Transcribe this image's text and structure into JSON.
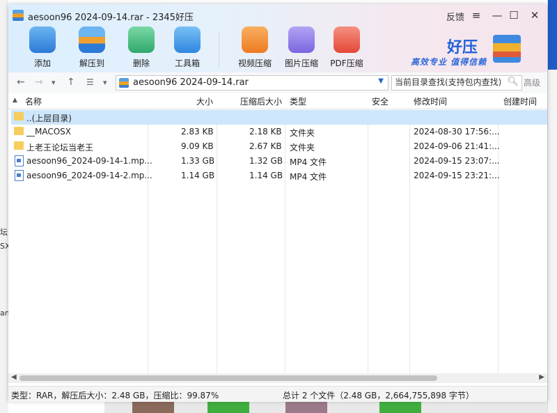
{
  "window": {
    "title": "aesoon96 2024-09-14.rar - 2345好压",
    "feedback_label": "反馈",
    "menu_icon": "≡",
    "minimize_icon": "—",
    "maximize_icon": "☐",
    "close_icon": "✕"
  },
  "toolbar": {
    "items": [
      {
        "label": "添加",
        "icon": "add-archive-icon",
        "color": "#3a8ee0"
      },
      {
        "label": "解压到",
        "icon": "extract-icon",
        "color": "#3a8ee0"
      },
      {
        "label": "删除",
        "icon": "delete-icon",
        "color": "#39b37a"
      },
      {
        "label": "工具箱",
        "icon": "toolbox-icon",
        "color": "#3a9ae6"
      },
      {
        "label": "视频压缩",
        "icon": "video-compress-icon",
        "color": "#f08a2c"
      },
      {
        "label": "图片压缩",
        "icon": "image-compress-icon",
        "color": "#8a7ae8"
      },
      {
        "label": "PDF压缩",
        "icon": "pdf-compress-icon",
        "color": "#ec5a4a"
      }
    ]
  },
  "brand": {
    "name": "好压",
    "slogan": "高效专业  值得信赖"
  },
  "address": {
    "path": "aesoon96 2024-09-14.rar",
    "search_placeholder": "当前目录查找(支持包内查找)",
    "advanced_label": "高级"
  },
  "columns": [
    "名称",
    "大小",
    "压缩后大小",
    "类型",
    "安全",
    "修改时间",
    "创建时间"
  ],
  "rows": [
    {
      "name": "..(上层目录)",
      "size": "",
      "packed": "",
      "type": "",
      "safe": "",
      "modified": "",
      "kind": "folder",
      "selected": true
    },
    {
      "name": "__MACOSX",
      "size": "2.83 KB",
      "packed": "2.18 KB",
      "type": "文件夹",
      "safe": "",
      "modified": "2024-08-30 17:56:...",
      "kind": "folder",
      "selected": false
    },
    {
      "name": "上老王论坛当老王",
      "size": "9.09 KB",
      "packed": "2.67 KB",
      "type": "文件夹",
      "safe": "",
      "modified": "2024-09-06 21:41:...",
      "kind": "folder",
      "selected": false
    },
    {
      "name": "aesoon96_2024-09-14-1.mp...",
      "size": "1.33 GB",
      "packed": "1.32 GB",
      "type": "MP4 文件",
      "safe": "",
      "modified": "2024-09-15 23:07:...",
      "kind": "video",
      "selected": false
    },
    {
      "name": "aesoon96_2024-09-14-2.mp...",
      "size": "1.14 GB",
      "packed": "1.14 GB",
      "type": "MP4 文件",
      "safe": "",
      "modified": "2024-09-15 23:21:...",
      "kind": "video",
      "selected": false
    }
  ],
  "status": {
    "left": "类型：RAR，解压后大小：2.48 GB，压缩比：99.87%",
    "right": "总计 2 个文件（2.48 GB，2,664,755,898 字节）"
  },
  "background": {
    "left_fragments": [
      "坛",
      "SX",
      "an"
    ]
  }
}
